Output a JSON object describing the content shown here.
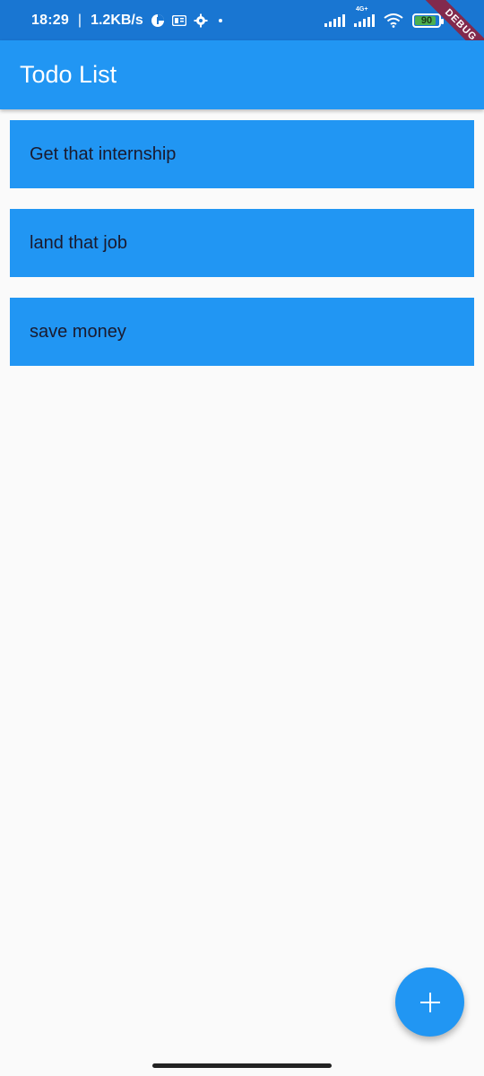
{
  "status_bar": {
    "time": "18:29",
    "separator": "|",
    "speed": "1.2KB/s",
    "network_label": "4G+",
    "battery": "90",
    "battery_level": 0.9,
    "icons": [
      "data-saver-icon",
      "sim-icon",
      "gear-icon",
      "dot-icon",
      "signal-icon",
      "signal-icon",
      "wifi-icon",
      "battery-icon"
    ]
  },
  "debug_banner": "DEBUG",
  "app_bar": {
    "title": "Todo List"
  },
  "todos": [
    {
      "text": "Get that internship"
    },
    {
      "text": "land that job"
    },
    {
      "text": "save money"
    }
  ],
  "fab": {
    "icon": "plus-icon"
  },
  "colors": {
    "primary": "#2196f3",
    "status_bar": "#1976d2",
    "background": "#fafafa",
    "battery_green": "#4caf50"
  }
}
